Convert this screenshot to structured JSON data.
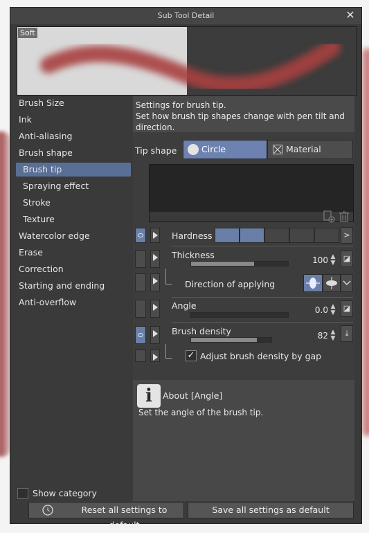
{
  "window": {
    "title": "Sub Tool Detail",
    "close_icon": "✕"
  },
  "preview": {
    "label": "Soft",
    "stroke_color": "#a33a3a"
  },
  "sidebar": {
    "items": [
      {
        "label": "Brush Size"
      },
      {
        "label": "Ink"
      },
      {
        "label": "Anti-aliasing"
      },
      {
        "label": "Brush shape"
      },
      {
        "label": "Brush tip",
        "selected": true
      },
      {
        "label": "Spraying effect"
      },
      {
        "label": "Stroke"
      },
      {
        "label": "Texture"
      },
      {
        "label": "Watercolor edge"
      },
      {
        "label": "Erase"
      },
      {
        "label": "Correction"
      },
      {
        "label": "Starting and ending"
      },
      {
        "label": "Anti-overflow"
      }
    ],
    "show_category_label": "Show category"
  },
  "panel": {
    "description_line1": "Settings for brush tip.",
    "description_line2": "Set how brush tip shapes change with pen tilt and",
    "description_line3": "direction.",
    "tip_shape_label": "Tip shape",
    "tip_circle_label": "Circle",
    "tip_material_label": "Material",
    "hardness": {
      "label": "Hardness",
      "level": 2,
      "steps": 5
    },
    "thickness": {
      "label": "Thickness",
      "value": "100",
      "fraction": 0.65
    },
    "direction": {
      "label": "Direction of applying"
    },
    "angle": {
      "label": "Angle",
      "value": "0.0",
      "fraction": 0.0
    },
    "brush_density": {
      "label": "Brush density",
      "value": "82",
      "fraction": 0.82
    },
    "adjust_density": {
      "label": "Adjust brush density by gap",
      "checked": "✓"
    }
  },
  "about": {
    "icon": "i",
    "title": "About [Angle]",
    "text": "Set the angle of the brush tip."
  },
  "footer": {
    "reset_label": "Reset all settings to default",
    "save_label": "Save all settings as default"
  },
  "colors": {
    "accent": "#6a7fa8",
    "selected": "#5a6f95",
    "background": "#3a3a3a"
  }
}
